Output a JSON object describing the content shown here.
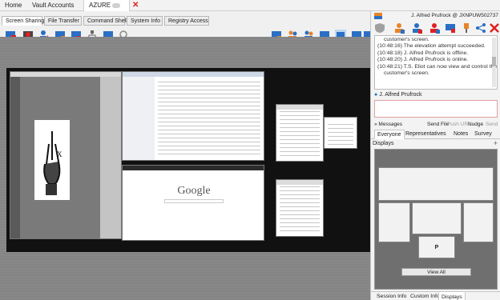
{
  "top_tabs": [
    "Home",
    "Vault Accounts",
    "AZURE"
  ],
  "session_tabs": [
    "Screen Sharing",
    "File Transfer",
    "Command Shell",
    "System Info",
    "Registry Access"
  ],
  "remote_screen": {
    "search_text": "Google"
  },
  "user_line": "J. Alfred Prufrock @ JXNPUW502737",
  "chat": {
    "lines": [
      "customer's screen.",
      "(10:48:16) The elevation attempt succeeded.",
      "(10:48:18) J. Alfred Prufrock is offline.",
      "(10:48:20) J. Alfred Prufrock is online.",
      "(10:48:21) T.S. Eliot can now view and control the",
      "customer's screen."
    ],
    "participant": "J. Alfred Prufrock"
  },
  "message_bar": {
    "toggle": "» Messages",
    "send_file": "Send File",
    "push_url": "Push URL",
    "nudge": "Nudge",
    "send": "Send"
  },
  "group_tabs": [
    "Everyone",
    "Representatives",
    "Notes",
    "Survey"
  ],
  "displays": {
    "title": "Displays",
    "plus": "+",
    "primary_label": "P",
    "view_all": "View All"
  },
  "bottom_tabs": [
    "Session Info",
    "Custom Info",
    "Displays"
  ],
  "colors": {
    "accent_red": "#e02020",
    "accent_blue": "#2a6fc4",
    "accent_orange": "#e8842a"
  }
}
